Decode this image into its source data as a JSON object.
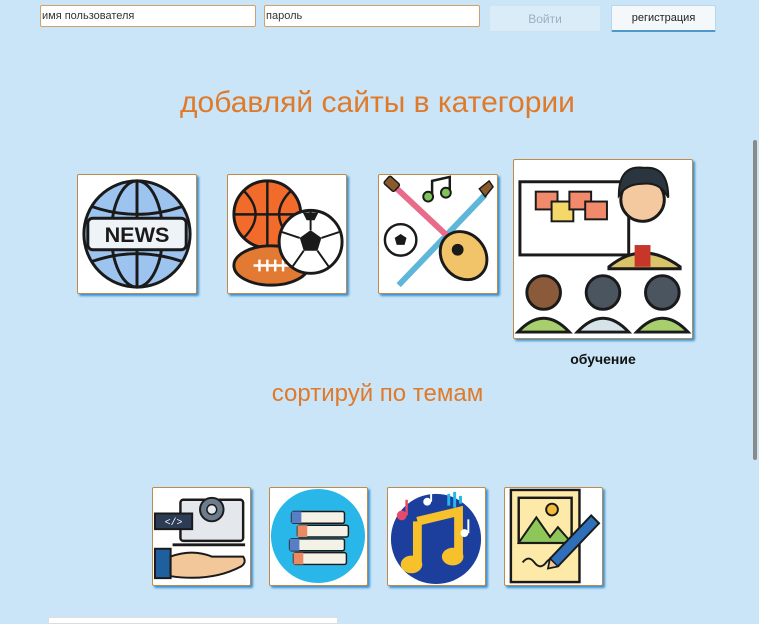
{
  "header": {
    "username_placeholder": "имя пользователя",
    "password_placeholder": "пароль",
    "login_label": "Войти",
    "register_label": "регистрация"
  },
  "main": {
    "heading_categories": "добавляй сайты в категории",
    "heading_topics": "сортируй по темам",
    "categories": [
      {
        "icon": "news-globe-icon"
      },
      {
        "icon": "sports-balls-icon"
      },
      {
        "icon": "hobbies-guitar-icon"
      },
      {
        "icon": "education-classroom-icon",
        "caption": "обучение"
      }
    ],
    "topics": [
      {
        "icon": "coding-hand-icon"
      },
      {
        "icon": "books-stack-icon"
      },
      {
        "icon": "music-note-icon"
      },
      {
        "icon": "drawing-picture-icon"
      }
    ]
  },
  "colors": {
    "background": "#c9e5f7",
    "heading": "#e07a2a",
    "card_border": "#c08a4a",
    "card_shadow": "#3a8fd0"
  }
}
